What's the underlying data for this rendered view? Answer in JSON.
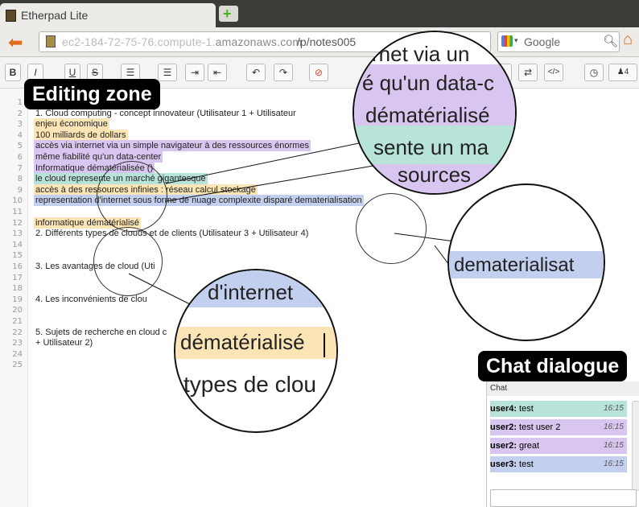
{
  "browser": {
    "tab_title": "Etherpad Lite",
    "url_host_blur": "ec2-184-72-75-76.compute-1.",
    "url_host_bold": "amazonaws.com",
    "url_path": "/p/notes005",
    "search_placeholder": "Google"
  },
  "toolbar": {
    "bold": "B",
    "italic": "I",
    "underline": "U",
    "strike": "S",
    "users_count": "4"
  },
  "callouts": {
    "editing_zone": "Editing zone",
    "chat_dialogue": "Chat dialogue"
  },
  "line_numbers": [
    "1",
    "2",
    "3",
    "4",
    "5",
    "6",
    "7",
    "8",
    "9",
    "10",
    "11",
    "12",
    "13",
    "14",
    "15",
    "16",
    "17",
    "18",
    "19",
    "20",
    "21",
    "22",
    "23",
    "24",
    "25"
  ],
  "lines": [
    {
      "text": "",
      "color": ""
    },
    {
      "text": "1. Cloud computing - concept innovateur (Utilisateur 1 + Utilisateur",
      "color": ""
    },
    {
      "text": "enjeu économique",
      "color": "#fbe5b6"
    },
    {
      "text": "100 milliards de dollars",
      "color": "#fbe5b6"
    },
    {
      "text": " accès via internet via un simple navigateur à des ressources énormes",
      "color": "#d8c6f0"
    },
    {
      "text": " même fiabilité qu'un data-center",
      "color": "#d8c6f0"
    },
    {
      "text": "Informatique dématérialisée ()",
      "color": "#d8c6f0"
    },
    {
      "text": "le cloud represente un marché gigantesque",
      "color": "#b7e3d8"
    },
    {
      "text": " accès à des ressources infinies : réseau calcul stockage",
      "color": "#fbe5b6"
    },
    {
      "text": "representation  d'internet sous forme de nuage complexite disparé dematerialisation",
      "color": "#c3cfee"
    },
    {
      "text": "",
      "color": ""
    },
    {
      "text": "informatique dématérialisé",
      "color": "#fbe5b6"
    },
    {
      "text": "2. Différents types de clouds et de clients (Utilisateur 3 + Utilisateur 4)",
      "color": ""
    },
    {
      "text": "",
      "color": ""
    },
    {
      "text": "",
      "color": ""
    },
    {
      "text": "3. Les avantages de cloud (Uti",
      "color": ""
    },
    {
      "text": "",
      "color": ""
    },
    {
      "text": "",
      "color": ""
    },
    {
      "text": "4. Les inconvénients de clou",
      "color": ""
    },
    {
      "text": "",
      "color": ""
    },
    {
      "text": "",
      "color": ""
    },
    {
      "text": "5. Sujets de recherche en cloud c",
      "color": ""
    },
    {
      "text": "+ Utilisateur 2)",
      "color": ""
    },
    {
      "text": "",
      "color": ""
    },
    {
      "text": "",
      "color": ""
    }
  ],
  "lenses": {
    "top_lines": [
      "rnet via un",
      "é qu'un data-c",
      "dématérialisé",
      "sente un ma",
      "sources"
    ],
    "right_text": "dematerialisat",
    "bottom_lines": [
      "d'internet",
      "dématérialisé",
      "types de clou"
    ]
  },
  "chat": {
    "header": "Chat",
    "messages": [
      {
        "user": "user4:",
        "text": "test",
        "time": "16:15",
        "color": "#b7e3d8"
      },
      {
        "user": "user2:",
        "text": "test user 2",
        "time": "16:15",
        "color": "#d8c6f0"
      },
      {
        "user": "user2:",
        "text": "great",
        "time": "16:15",
        "color": "#d8c6f0"
      },
      {
        "user": "user3:",
        "text": "test",
        "time": "16:15",
        "color": "#c3cfee"
      }
    ]
  }
}
